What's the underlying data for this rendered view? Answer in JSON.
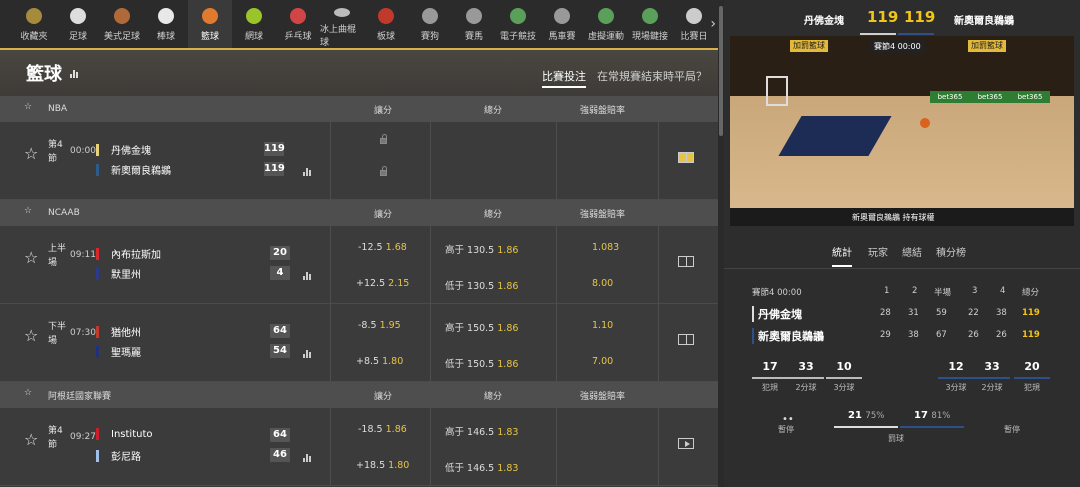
{
  "nav": [
    {
      "label": "收藏夾",
      "icon": "star-icon",
      "color": "#a68b3c"
    },
    {
      "label": "足球",
      "icon": "soccer-icon",
      "color": "#dddddd"
    },
    {
      "label": "美式足球",
      "icon": "football-icon",
      "color": "#b06a3a"
    },
    {
      "label": "棒球",
      "icon": "baseball-icon",
      "color": "#e8e8e8"
    },
    {
      "label": "籃球",
      "icon": "basketball-icon",
      "color": "#e07a2e"
    },
    {
      "label": "網球",
      "icon": "tennis-icon",
      "color": "#9ac42a"
    },
    {
      "label": "乒乓球",
      "icon": "pingpong-icon",
      "color": "#d04545"
    },
    {
      "label": "冰上曲棍球",
      "icon": "hockey-icon",
      "color": "#bbbbbb"
    },
    {
      "label": "板球",
      "icon": "cricket-icon",
      "color": "#c03a2b"
    },
    {
      "label": "賽狗",
      "icon": "greyhound-icon",
      "color": "#999999"
    },
    {
      "label": "賽馬",
      "icon": "horse-icon",
      "color": "#999999"
    },
    {
      "label": "電子競技",
      "icon": "esports-icon",
      "color": "#5aa05a"
    },
    {
      "label": "馬車賽",
      "icon": "harness-icon",
      "color": "#999999"
    },
    {
      "label": "虛擬運動",
      "icon": "virtual-icon",
      "color": "#5aa05a"
    },
    {
      "label": "現場鍵接",
      "icon": "live-icon",
      "color": "#5aa05a"
    },
    {
      "label": "比賽日",
      "icon": "calendar-icon",
      "color": "#cccccc"
    }
  ],
  "header": {
    "title": "籃球",
    "tab_bets": "比賽投注",
    "tab_halftime": "在常規賽結束時平局？"
  },
  "leagues": [
    {
      "name": "NBA",
      "cols": [
        "讓分",
        "總分",
        "強弱盤賠率"
      ]
    },
    {
      "name": "NCAAB",
      "cols": [
        "讓分",
        "總分",
        "強弱盤賠率"
      ]
    },
    {
      "name": "阿根廷國家聯賽",
      "cols": [
        "讓分",
        "總分",
        "強弱盤賠率"
      ]
    }
  ],
  "matches": [
    {
      "period": "第4節",
      "time": "00:00",
      "home": "丹佛金塊",
      "away": "新奧爾良鵜鶘",
      "hs": "119",
      "as": "119"
    },
    {
      "period": "上半場",
      "time": "09:11",
      "home": "內布拉斯加",
      "away": "默里州",
      "hs": "20",
      "as": "4",
      "h_hcap": "-12.5",
      "h_hcap_p": "1.68",
      "h_tot": "高于 130.5",
      "h_tot_p": "1.86",
      "h_ml": "1.083",
      "a_hcap": "+12.5",
      "a_hcap_p": "2.15",
      "a_tot": "低于 130.5",
      "a_tot_p": "1.86",
      "a_ml": "8.00"
    },
    {
      "period": "下半場",
      "time": "07:30",
      "home": "猶他州",
      "away": "聖瑪麗",
      "hs": "64",
      "as": "54",
      "h_hcap": "-8.5",
      "h_hcap_p": "1.95",
      "h_tot": "高于 150.5",
      "h_tot_p": "1.86",
      "h_ml": "1.10",
      "a_hcap": "+8.5",
      "a_hcap_p": "1.80",
      "a_tot": "低于 150.5",
      "a_tot_p": "1.86",
      "a_ml": "7.00"
    },
    {
      "period": "第4節",
      "time": "09:27",
      "home": "Instituto",
      "away": "彭尼路",
      "hs": "64",
      "as": "46",
      "h_hcap": "-18.5",
      "h_hcap_p": "1.86",
      "h_tot": "高于 146.5",
      "h_tot_p": "1.83",
      "h_ml": "",
      "a_hcap": "+18.5",
      "a_hcap_p": "1.80",
      "a_tot": "低于 146.5",
      "a_tot_p": "1.83",
      "a_ml": ""
    }
  ],
  "live": {
    "home": "丹佛金塊",
    "away": "新奧爾良鵜鶘",
    "hs": "119",
    "as": "119",
    "banner_left": "加罰籃球",
    "banner_right": "加罰籃球",
    "quarter": "賽節4 00:00",
    "ad1": "bet365",
    "ad2": "bet365",
    "ad3": "bet365",
    "possession": "新奧爾良鵜鶘 持有球權",
    "tabs": [
      "統計",
      "玩家",
      "總結",
      "積分榜"
    ],
    "table_head": [
      "賽節4 00:00",
      "1",
      "2",
      "半場",
      "3",
      "4",
      "總分"
    ],
    "rows": [
      {
        "team": "丹佛金塊",
        "q": [
          "28",
          "31",
          "59",
          "22",
          "38",
          "119"
        ]
      },
      {
        "team": "新奧爾良鵜鶘",
        "q": [
          "29",
          "38",
          "67",
          "26",
          "26",
          "119"
        ]
      }
    ],
    "stats_home": [
      {
        "v": "17",
        "l": "犯規"
      },
      {
        "v": "33",
        "l": "2分球"
      },
      {
        "v": "10",
        "l": "3分球"
      }
    ],
    "stats_away": [
      {
        "v": "12",
        "l": "3分球"
      },
      {
        "v": "33",
        "l": "2分球"
      },
      {
        "v": "20",
        "l": "犯規"
      }
    ],
    "timeout_label": "暫停",
    "timeout_label2": "暫停",
    "ft_home": "21",
    "ft_home_pct": "75%",
    "ft_away": "17",
    "ft_away_pct": "81%",
    "ft_label": "罰球"
  }
}
